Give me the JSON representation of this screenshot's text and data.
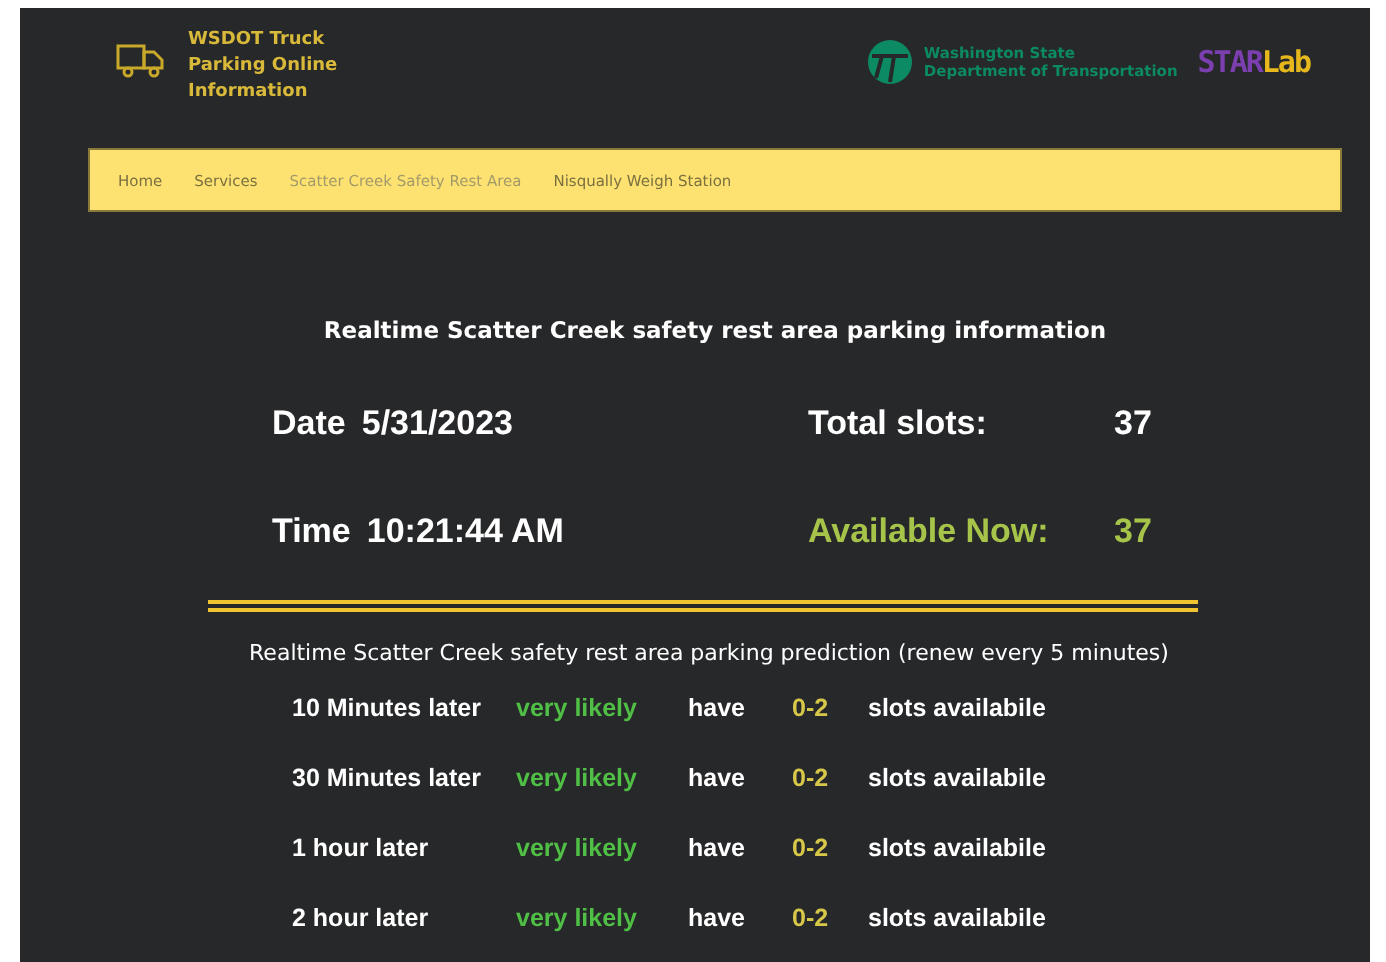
{
  "header": {
    "title": "WSDOT Truck Parking Online Information",
    "agency": [
      "Washington State",
      "Department of Transportation"
    ],
    "lab_logo": {
      "part_1": "STAR",
      "part_2": "Lab"
    }
  },
  "nav": [
    {
      "label": "Home",
      "selected": false
    },
    {
      "label": "Services",
      "selected": false
    },
    {
      "label": "Scatter Creek Safety Rest Area",
      "selected": true
    },
    {
      "label": "Nisqually Weigh Station",
      "selected": false
    }
  ],
  "realtime": {
    "title": "Realtime Scatter Creek safety rest area parking information",
    "date_label": "Date",
    "date": "5/31/2023",
    "time_label": "Time",
    "time": "10:21:44 AM",
    "total_label": "Total slots:",
    "total": "37",
    "available_label": "Available Now:",
    "available": "37"
  },
  "prediction": {
    "title": "Realtime Scatter Creek safety rest area parking prediction (renew every 5 minutes)",
    "rows": [
      {
        "when": "10 Minutes later",
        "likelihood": "very likely",
        "verb": "have",
        "range": "0-2",
        "unit": "slots availabile"
      },
      {
        "when": "30 Minutes later",
        "likelihood": "very likely",
        "verb": "have",
        "range": "0-2",
        "unit": "slots availabile"
      },
      {
        "when": "1 hour later",
        "likelihood": "very likely",
        "verb": "have",
        "range": "0-2",
        "unit": "slots availabile"
      },
      {
        "when": "2 hour later",
        "likelihood": "very likely",
        "verb": "have",
        "range": "0-2",
        "unit": "slots availabile"
      }
    ]
  }
}
